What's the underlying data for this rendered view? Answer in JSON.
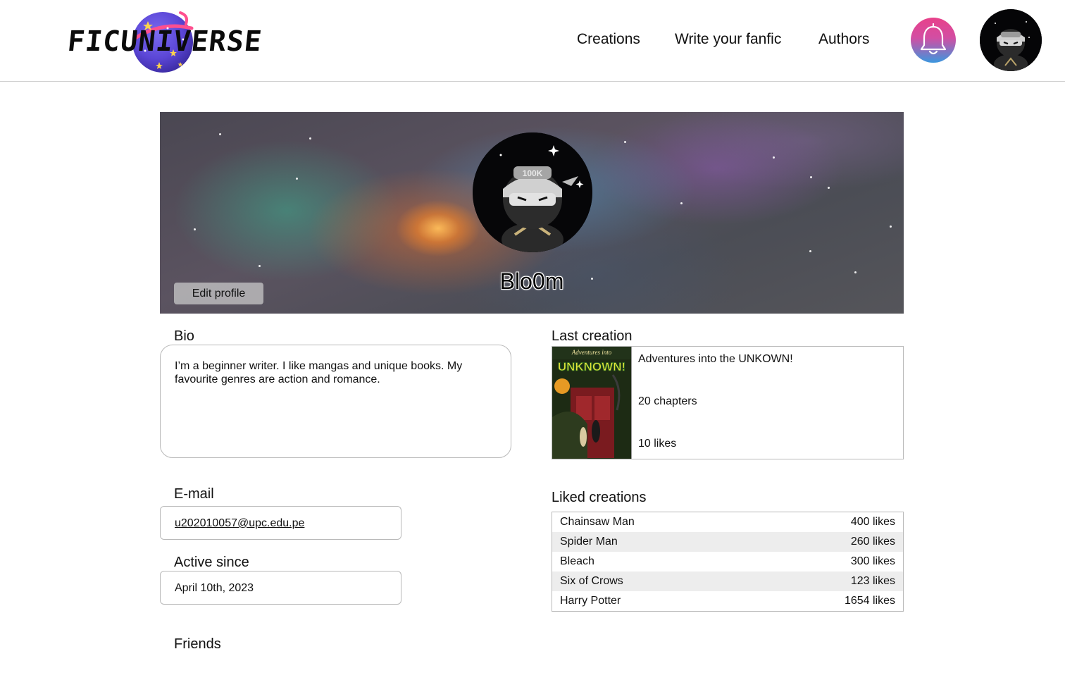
{
  "brand": {
    "name": "FICUNIVERSE"
  },
  "nav": {
    "creations": "Creations",
    "write": "Write your fanfic",
    "authors": "Authors"
  },
  "icons": {
    "notifications": "bell-icon",
    "avatar": "ninja-avatar"
  },
  "colors": {
    "bell_gradient_top": "#e8418a",
    "bell_gradient_bottom": "#3c97de"
  },
  "profile": {
    "username": "Blo0m",
    "edit_label": "Edit profile",
    "avatar_badge": "100K"
  },
  "bio": {
    "label": "Bio",
    "text": "I’m a beginner writer. I like mangas and unique books. My favourite genres are action and romance."
  },
  "email": {
    "label": "E-mail",
    "value": "u202010057@upc.edu.pe"
  },
  "active_since": {
    "label": "Active since",
    "value": "April 10th, 2023"
  },
  "friends": {
    "label": "Friends"
  },
  "last_creation": {
    "label": "Last creation",
    "title": "Adventures into the UNKOWN!",
    "chapters": "20 chapters",
    "likes": "10 likes",
    "cover_top": "Adventures into",
    "cover_title": "UNKNOWN!"
  },
  "liked_creations": {
    "label": "Liked creations",
    "items": [
      {
        "title": "Chainsaw Man",
        "likes": "400 likes"
      },
      {
        "title": "Spider Man",
        "likes": "260 likes"
      },
      {
        "title": "Bleach",
        "likes": "300 likes"
      },
      {
        "title": "Six of Crows",
        "likes": "123 likes"
      },
      {
        "title": "Harry Potter",
        "likes": "1654 likes"
      }
    ]
  }
}
